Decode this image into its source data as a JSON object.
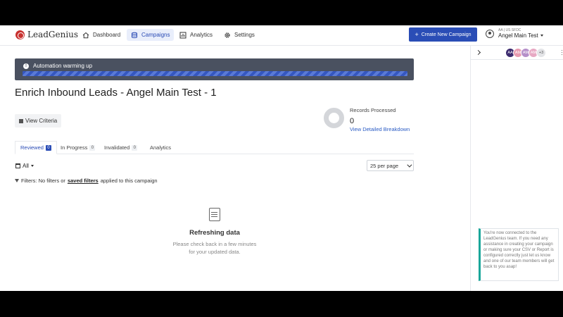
{
  "nav": {
    "logo_text": "LeadGenius",
    "items": [
      {
        "label": "Dashboard",
        "icon": "home-icon"
      },
      {
        "label": "Campaigns",
        "icon": "database-icon"
      },
      {
        "label": "Analytics",
        "icon": "chart-icon"
      },
      {
        "label": "Settings",
        "icon": "gear-icon"
      }
    ],
    "create_label": "Create New Campaign",
    "user_sub": "AA | US SFDC",
    "user_name": "Angel Main Test"
  },
  "banner": {
    "text": "Automation warming up",
    "progress": 1.0
  },
  "page": {
    "title": "Enrich Inbound Leads - Angel Main Test - 1",
    "view_criteria": "View Criteria"
  },
  "records": {
    "label": "Records Processed",
    "value": "0",
    "link": "View Detailed Breakdown"
  },
  "tabs": [
    {
      "label": "Reviewed",
      "count": "0"
    },
    {
      "label": "In Progress",
      "count": "0"
    },
    {
      "label": "Invalidated",
      "count": "0"
    },
    {
      "label": "Analytics",
      "count": ""
    }
  ],
  "filters": {
    "all_label": "All",
    "per_page": "25 per page",
    "prefix": "Filters: No filters or",
    "link": "saved filters",
    "suffix": "applied to this campaign"
  },
  "empty": {
    "title": "Refreshing data",
    "line1": "Please check back in a few minutes",
    "line2": "for your updated data."
  },
  "side": {
    "avatars": [
      {
        "initials": "AA",
        "color": "#3b2a6e"
      },
      {
        "initials": "AM",
        "color": "#e79ab0"
      },
      {
        "initials": "AM",
        "color": "#b58fc9"
      },
      {
        "initials": "AM",
        "color": "#e7a8c3"
      },
      {
        "initials": "+3",
        "color": "#e3e4e7"
      }
    ],
    "toast": "You're now connected to the LeadGenius team. If you need any assistance in creating your campaign or making sure your CSV or Report is configured correctly just let us know and one of our team members will get back to you asap!"
  }
}
